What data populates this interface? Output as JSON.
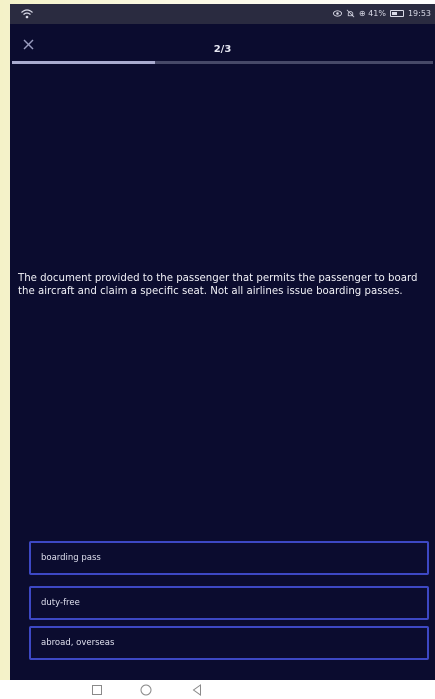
{
  "status_bar": {
    "wifi_icon": "wifi-icon",
    "status_text": "⊕ 41%",
    "time": "19:53"
  },
  "quiz": {
    "close_icon": "close-icon",
    "counter": "2/3",
    "progress": 0.34,
    "question": "The document provided to the passenger that permits the passenger to board the aircraft and claim a specific seat. Not all airlines issue boarding passes.",
    "answers": [
      {
        "label": "boarding pass"
      },
      {
        "label": "duty-free"
      },
      {
        "label": "abroad, overseas"
      }
    ]
  },
  "nav_bar": {
    "icons": [
      "square-icon",
      "circle-icon",
      "back-triangle-icon"
    ]
  },
  "colors": {
    "background": "#0b0c2f",
    "answer_border": "#3d48c4",
    "progress_fill": "#a9abcf"
  }
}
